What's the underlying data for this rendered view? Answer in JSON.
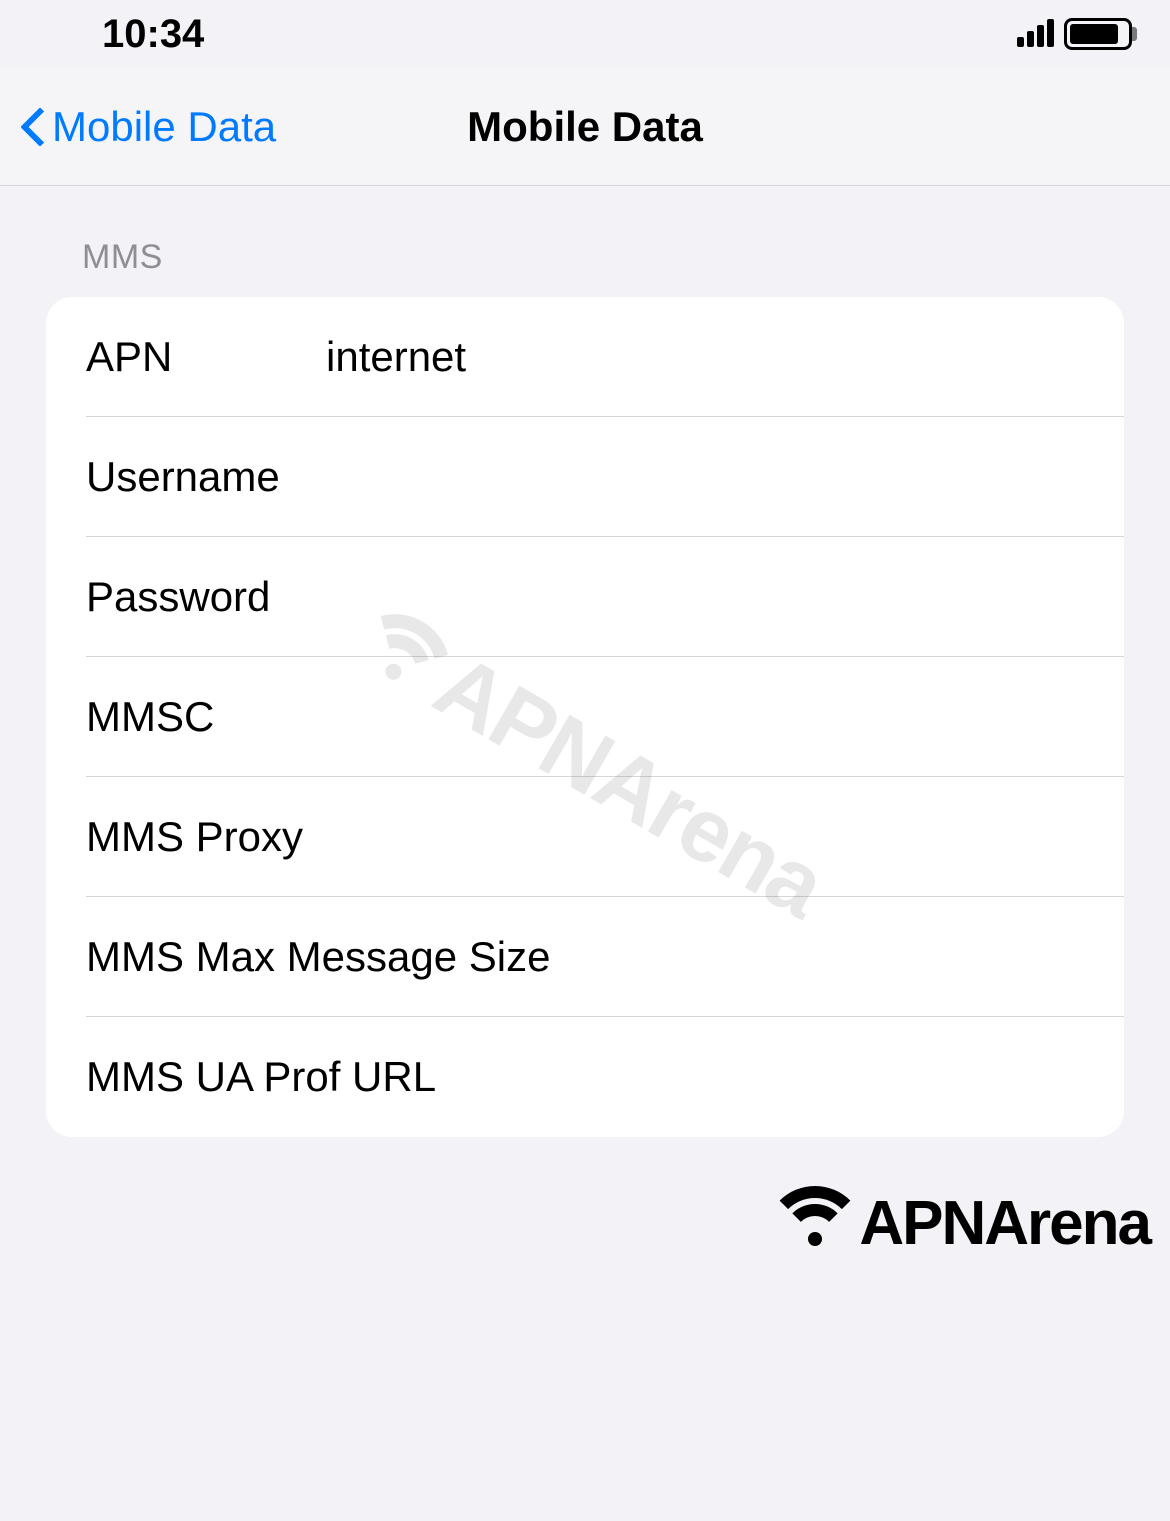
{
  "status": {
    "time": "10:34"
  },
  "nav": {
    "back_label": "Mobile Data",
    "title": "Mobile Data"
  },
  "section": {
    "header": "MMS"
  },
  "fields": {
    "apn": {
      "label": "APN",
      "value": "internet"
    },
    "username": {
      "label": "Username",
      "value": ""
    },
    "password": {
      "label": "Password",
      "value": ""
    },
    "mmsc": {
      "label": "MMSC",
      "value": ""
    },
    "mms_proxy": {
      "label": "MMS Proxy",
      "value": ""
    },
    "mms_max_size": {
      "label": "MMS Max Message Size",
      "value": ""
    },
    "mms_ua_prof": {
      "label": "MMS UA Prof URL",
      "value": ""
    }
  },
  "watermark": {
    "text": "APNArena"
  },
  "brand": {
    "text": "APNArena"
  }
}
